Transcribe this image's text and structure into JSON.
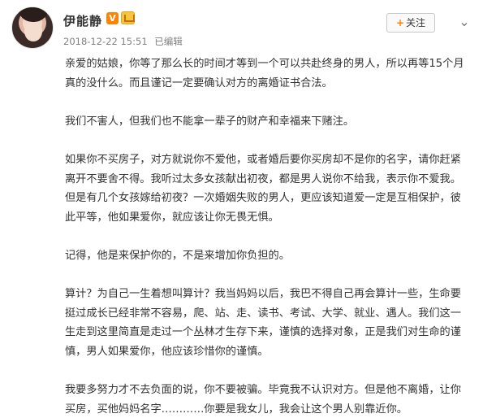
{
  "post": {
    "username": "伊能静",
    "verified_badge": "V",
    "timestamp": "2018-12-22 15:51",
    "edited_label": "已编辑",
    "follow_label": "关注",
    "follow_icon": "plus-icon",
    "more_icon": "chevron-down-icon",
    "paragraphs": [
      "亲爱的姑娘，你等了那么长的时间才等到一个可以共赴终身的男人，所以再等15个月真的没什么。而且谨记一定要确认对方的离婚证书合法。",
      "我们不害人，但我们也不能拿一辈子的财产和幸福来下赌注。",
      "如果你不买房子，对方就说你不爱他，或者婚后要你买房却不是你的名字，请你赶紧离开不要舍不得。我听过太多女孩献出初夜，都是男人说你不给我，表示你不爱我。但是有几个女孩嫁给初夜？一次婚姻失败的男人，更应该知道爱一定是互相保护，彼此平等，他如果爱你，就应该让你无畏无惧。",
      "记得，他是来保护你的，不是来增加你负担的。",
      "算计？为自己一生着想叫算计？我当妈妈以后，我巴不得自己再会算计一些，生命要挺过成长已经非常不容易，爬、站、走、读书、考试、大学、就业、遇人。我们这一生走到这里简直是走过一个丛林才生存下来，谨慎的选择对象，正是我们对生命的谨慎，男人如果爱你，他应该珍惜你的谨慎。",
      "我要多努力才不去负面的说，你不要被骗。毕竟我不认识对方。但是他不离婚，让你买房，买他妈妈名字…………你要是我女儿，我会让这个男人别靠近你。"
    ]
  },
  "colors": {
    "text": "#333333",
    "meta": "#808080",
    "verified": "#ff8200"
  }
}
